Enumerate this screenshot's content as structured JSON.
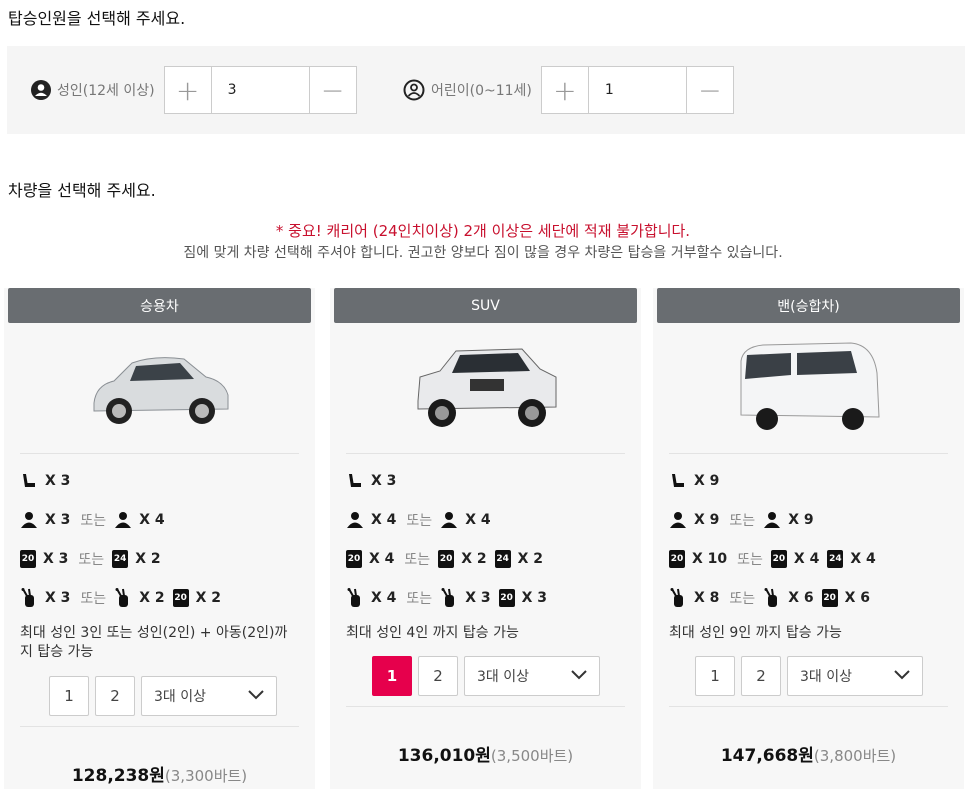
{
  "passengers": {
    "title": "탑승인원을 선택해 주세요.",
    "adult": {
      "label": "성인(12세 이상)",
      "value": "3",
      "plus": "+",
      "minus": "−"
    },
    "child": {
      "label": "어린이(0~11세)",
      "value": "1",
      "plus": "+",
      "minus": "−"
    }
  },
  "vehicle": {
    "title": "차량을 선택해 주세요.",
    "warning": "* 중요! 캐리어 (24인치이상) 2개 이상은 세단에 적재 불가합니다.",
    "notice": "짐에 맞게 차량 선택해 주셔야 합니다. 권고한 양보다 짐이 많을 경우 차량은 탑승을 거부할수 있습니다.",
    "or_label": "또는",
    "cards": [
      {
        "name": "승용차",
        "seats": "X 3",
        "people": [
          "X 3",
          "X 4"
        ],
        "luggage": [
          {
            "size": "20",
            "count": "X 3"
          },
          {
            "size": "24",
            "count": "X 2"
          }
        ],
        "golf": [
          "X 3",
          "X 2",
          "X 2"
        ],
        "max": "최대 성인 3인 또는 성인(2인) + 아동(2인)까지 탑승 가능",
        "qty": [
          "1",
          "2"
        ],
        "qty_select": "3대 이상",
        "price_won": "128,238원",
        "price_baht": "(3,300바트)",
        "selected": ""
      },
      {
        "name": "SUV",
        "seats": "X 3",
        "people": [
          "X 4",
          "X 4"
        ],
        "luggage": [
          {
            "size": "20",
            "count": "X 4"
          },
          {
            "size": "20",
            "count": "X 2"
          },
          {
            "size": "24",
            "count": "X 2"
          }
        ],
        "golf": [
          "X 4",
          "X 3",
          "X 3"
        ],
        "max": "최대 성인 4인 까지 탑승 가능",
        "qty": [
          "1",
          "2"
        ],
        "qty_select": "3대 이상",
        "price_won": "136,010원",
        "price_baht": "(3,500바트)",
        "selected": "1"
      },
      {
        "name": "밴(승합차)",
        "seats": "X 9",
        "people": [
          "X 9",
          "X 9"
        ],
        "luggage": [
          {
            "size": "20",
            "count": "X 10"
          },
          {
            "size": "20",
            "count": "X 4"
          },
          {
            "size": "24",
            "count": "X 4"
          }
        ],
        "golf": [
          "X 8",
          "X 6",
          "X 6"
        ],
        "max": "최대 성인 9인 까지 탑승 가능",
        "qty": [
          "1",
          "2"
        ],
        "qty_select": "3대 이상",
        "price_won": "147,668원",
        "price_baht": "(3,800바트)",
        "selected": ""
      }
    ]
  },
  "colors": {
    "accent": "#e6004c",
    "warning": "#c8102e",
    "card_header": "#696d71"
  }
}
